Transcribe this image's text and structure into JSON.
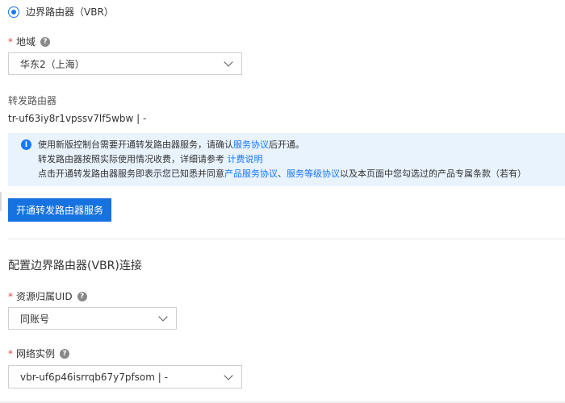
{
  "gateway_option": {
    "label": "边界路由器（VBR）",
    "selected": true
  },
  "region": {
    "required_mark": "*",
    "label": "地域",
    "help_icon": "?",
    "value": "华东2（上海）"
  },
  "transit_router": {
    "label": "转发路由器",
    "value": "tr-uf63iy8r1vpssv7lf5wbw | -"
  },
  "notice": {
    "icon": "i",
    "line1_prefix": "使用新版控制台需要开通转发路由器服务，请确认",
    "line1_link": "服务协议",
    "line1_suffix": "后开通。",
    "line2_prefix": "转发路由器按照实际使用情况收费，详细请参考 ",
    "line2_link": "计费说明",
    "line3_prefix": "点击开通转发路由器服务即表示您已知悉并同意",
    "line3_link1": "产品服务协议",
    "line3_sep": "、",
    "line3_link2": "服务等级协议",
    "line3_suffix": "以及本页面中您勾选过的产品专属条款（若有）"
  },
  "activate_button": {
    "label": "开通转发路由器服务"
  },
  "section": {
    "title": "配置边界路由器(VBR)连接"
  },
  "resource_uid": {
    "required_mark": "*",
    "label": "资源归属UID",
    "help_icon": "?",
    "value": "同账号"
  },
  "network_instance": {
    "required_mark": "*",
    "label": "网络实例",
    "help_icon": "?",
    "value": "vbr-uf6p46isrrqb67y7pfsom | -"
  },
  "colors": {
    "accent": "#1677ff",
    "primary_button": "#1672e0",
    "notice_bg": "#e9f3fe",
    "required": "#e64545"
  }
}
